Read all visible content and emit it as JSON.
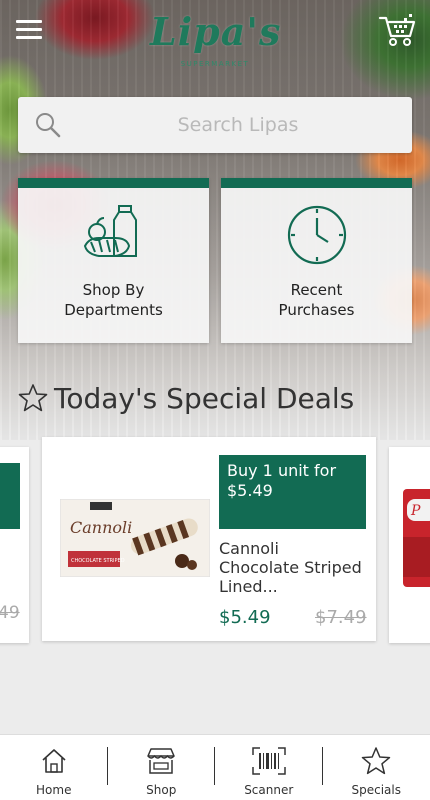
{
  "header": {
    "logo_text": "Lipa's",
    "logo_subtext": "SUPERMARKET"
  },
  "search": {
    "placeholder": "Search Lipas"
  },
  "quick_links": [
    {
      "label_line1": "Shop By",
      "label_line2": "Departments",
      "icon": "groceries-icon"
    },
    {
      "label_line1": "Recent",
      "label_line2": "Purchases",
      "icon": "clock-icon"
    }
  ],
  "deals": {
    "title": "Today's Special Deals",
    "items": [
      {
        "badge": "Buy 1 unit for $5.49",
        "name": "Cannoli Chocolate Striped Lined...",
        "price": "$5.49",
        "old_price": "$7.49",
        "image_brand": "Cannoli",
        "image_tag": "CHOCOLATE STRIPED"
      }
    ],
    "prev_old_price": "49"
  },
  "bottom_nav": [
    {
      "label": "Home",
      "icon": "home-icon"
    },
    {
      "label": "Shop",
      "icon": "shop-icon"
    },
    {
      "label": "Scanner",
      "icon": "barcode-icon"
    },
    {
      "label": "Specials",
      "icon": "star-icon"
    }
  ],
  "colors": {
    "brand_green": "#126b53",
    "logo_green": "#1f7a5c"
  }
}
